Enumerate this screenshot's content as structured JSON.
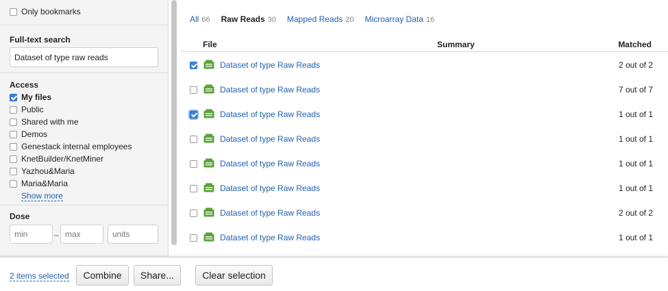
{
  "sidebar": {
    "only_bookmarks": {
      "label": "Only bookmarks",
      "checked": false
    },
    "fulltext": {
      "title": "Full-text search",
      "value": "Dataset of type raw reads"
    },
    "access": {
      "title": "Access",
      "options": [
        {
          "label": "My files",
          "checked": true
        },
        {
          "label": "Public",
          "checked": false
        },
        {
          "label": "Shared with me",
          "checked": false
        },
        {
          "label": "Demos",
          "checked": false
        },
        {
          "label": "Genestack internal employees",
          "checked": false
        },
        {
          "label": "KnetBuilder/KnetMiner",
          "checked": false
        },
        {
          "label": "Yazhou&Maria",
          "checked": false
        },
        {
          "label": "Maria&Maria",
          "checked": false
        }
      ],
      "show_more": "Show more"
    },
    "dose": {
      "title": "Dose",
      "min_placeholder": "min",
      "separator": "–",
      "max_placeholder": "max",
      "units_placeholder": "units"
    }
  },
  "tabs": [
    {
      "label": "All",
      "count": "66",
      "active": false
    },
    {
      "label": "Raw Reads",
      "count": "30",
      "active": true
    },
    {
      "label": "Mapped Reads",
      "count": "20",
      "active": false
    },
    {
      "label": "Microarray Data",
      "count": "16",
      "active": false
    }
  ],
  "table": {
    "columns": {
      "file": "File",
      "summary": "Summary",
      "matched": "Matched"
    },
    "rows": [
      {
        "name": "Dataset of type Raw Reads",
        "matched": "2 out of 2",
        "checked": true
      },
      {
        "name": "Dataset of type Raw Reads",
        "matched": "7 out of 7",
        "checked": false
      },
      {
        "name": "Dataset of type Raw Reads",
        "matched": "1 out of 1",
        "checked": true
      },
      {
        "name": "Dataset of type Raw Reads",
        "matched": "1 out of 1",
        "checked": false
      },
      {
        "name": "Dataset of type Raw Reads",
        "matched": "1 out of 1",
        "checked": false
      },
      {
        "name": "Dataset of type Raw Reads",
        "matched": "1 out of 1",
        "checked": false
      },
      {
        "name": "Dataset of type Raw Reads",
        "matched": "2 out of 2",
        "checked": false
      },
      {
        "name": "Dataset of type Raw Reads",
        "matched": "1 out of 1",
        "checked": false
      }
    ],
    "file_icon": "dataset-folder-icon",
    "icon_color": "#5aa33a"
  },
  "footer": {
    "selected": "2 items selected",
    "combine": "Combine",
    "share": "Share...",
    "clear": "Clear selection"
  }
}
